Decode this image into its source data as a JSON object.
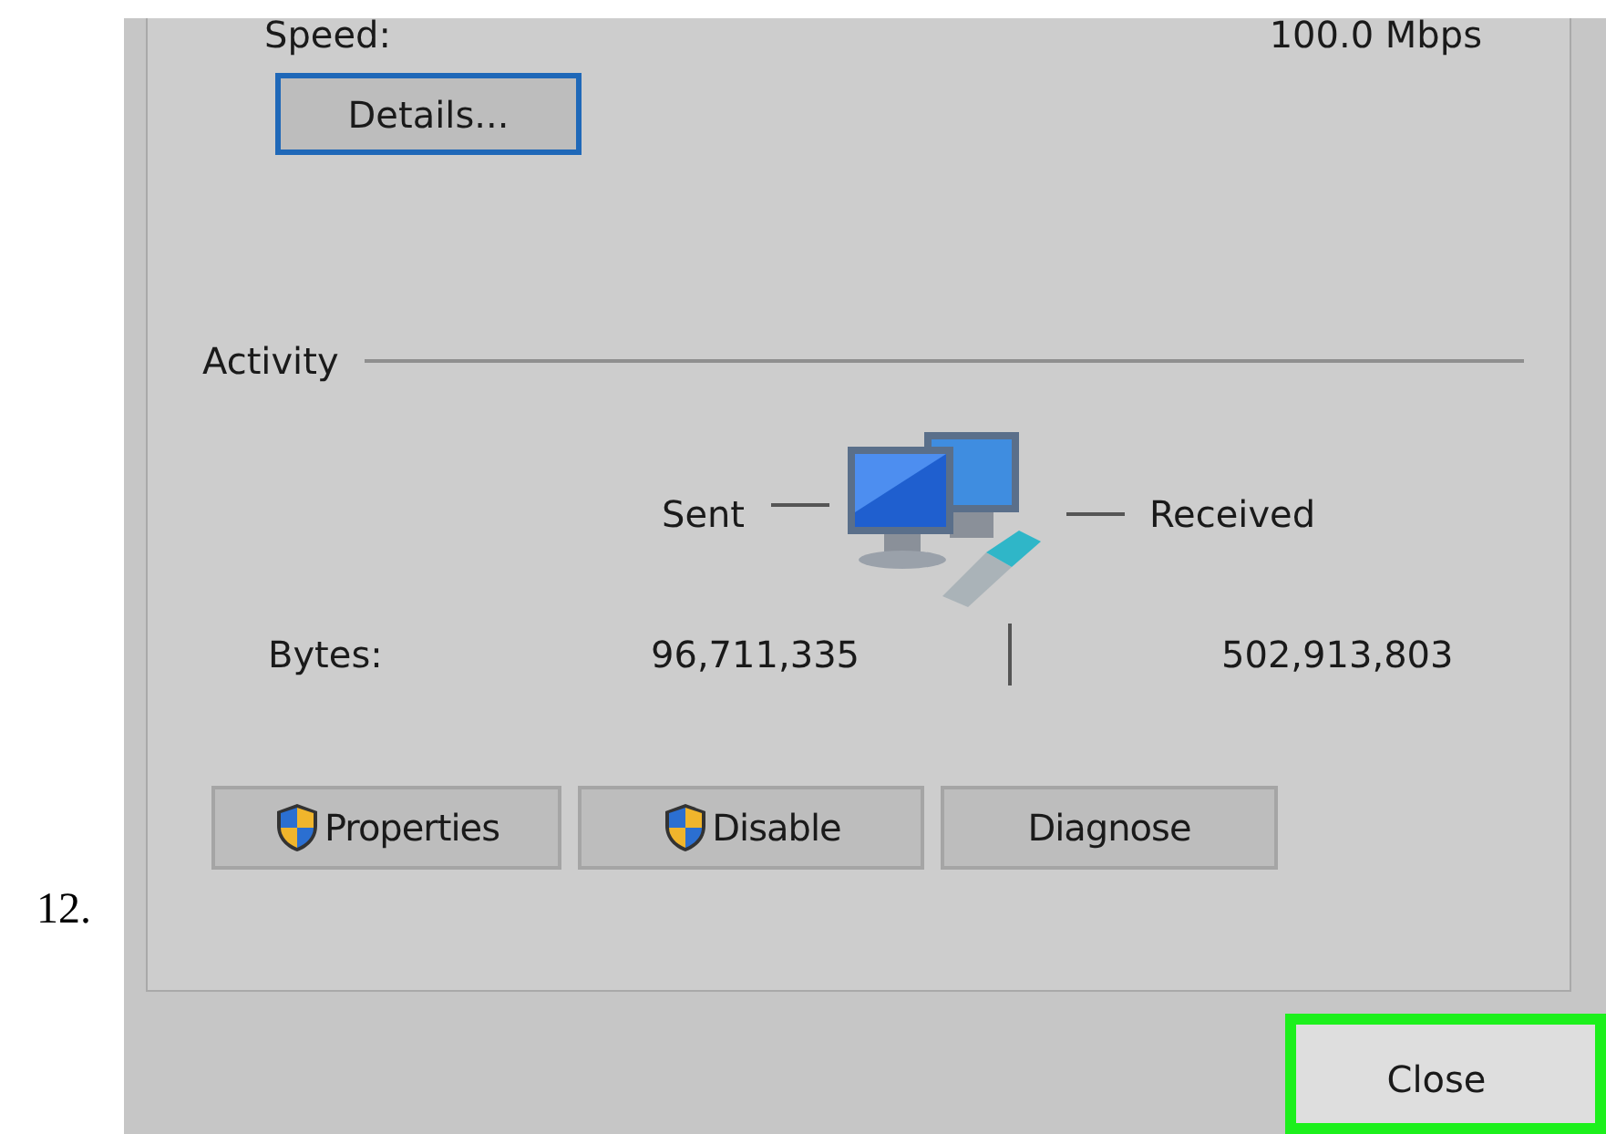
{
  "step_number": "12.",
  "speed": {
    "label": "Speed:",
    "value": "100.0 Mbps"
  },
  "details_button": "Details...",
  "activity": {
    "title": "Activity",
    "sent_label": "Sent",
    "received_label": "Received",
    "bytes_label": "Bytes:",
    "bytes_sent": "96,711,335",
    "bytes_received": "502,913,803"
  },
  "buttons": [
    {
      "label": "Properties",
      "shield": true
    },
    {
      "label": "Disable",
      "shield": true
    },
    {
      "label": "Diagnose",
      "shield": false
    }
  ],
  "close_button": {
    "label": "Close",
    "highlighted": true
  }
}
